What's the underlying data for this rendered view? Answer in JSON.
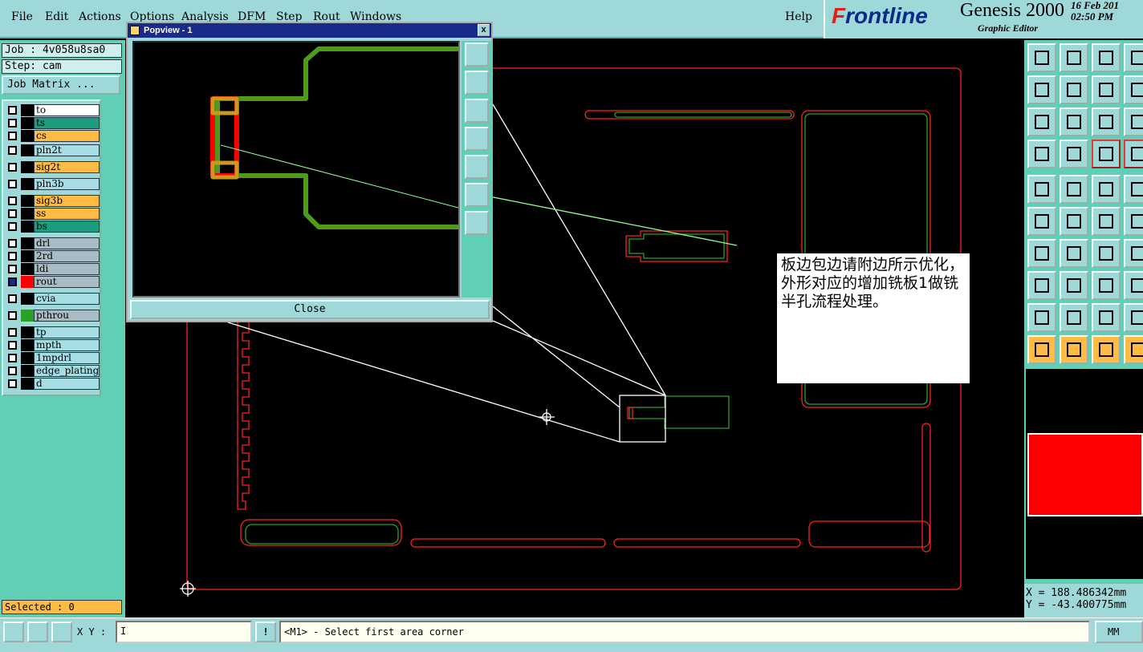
{
  "menu": [
    "File",
    "Edit",
    "Actions",
    "Options",
    "Analysis",
    "DFM",
    "Step",
    "Rout",
    "Windows"
  ],
  "help": "Help",
  "brand": {
    "logo_prefix": "F",
    "logo_rest": "rontline",
    "product": "Genesis 2000",
    "subtitle": "Graphic Editor",
    "date": "16 Feb 201",
    "time": "02:50 PM"
  },
  "left": {
    "job": "Job : 4v058u8sa0",
    "step": "Step: cam",
    "job_matrix": "Job Matrix ...",
    "selected": "Selected : 0",
    "layers": [
      {
        "name": "to",
        "color": "white"
      },
      {
        "name": "ts",
        "color": "teal"
      },
      {
        "name": "cs",
        "color": "orange"
      },
      {
        "name": "pln2t",
        "color": "lblue"
      },
      {
        "name": "sig2t",
        "color": "orange"
      },
      {
        "name": "pln3b",
        "color": "lblue"
      },
      {
        "name": "sig3b",
        "color": "orange"
      },
      {
        "name": "ss",
        "color": "orange"
      },
      {
        "name": "bs",
        "color": "teal"
      },
      {
        "name": "drl",
        "color": "grey"
      },
      {
        "name": "2rd",
        "color": "grey"
      },
      {
        "name": "ldi",
        "color": "grey"
      },
      {
        "name": "rout",
        "color": "grey"
      },
      {
        "name": "cvia",
        "color": "lblue"
      },
      {
        "name": "pthrou",
        "color": "grey"
      },
      {
        "name": "tp",
        "color": "lblue"
      },
      {
        "name": "mpth",
        "color": "lblue"
      },
      {
        "name": "1mpdrl",
        "color": "lblue"
      },
      {
        "name": "edge_plating",
        "color": "lblue"
      },
      {
        "name": "d",
        "color": "lblue"
      }
    ]
  },
  "popview": {
    "title": "Popview - 1",
    "close_x": "x",
    "close_button": "Close"
  },
  "note": "板边包边请附边所示优化，外形对应的增加铣板1做铣半孔流程处理。",
  "coords": {
    "x": "X = 188.486342mm",
    "y": "Y = -43.400775mm"
  },
  "bottom": {
    "xy_label": "X Y :",
    "xy_value": "I",
    "excl": "!",
    "status": "<M1> - Select first area corner",
    "unit": "MM"
  },
  "colors": {
    "panel": "#9fd8d8",
    "accent": "#5fd0b5",
    "rout": "#ff2020",
    "outline": "#2aa02a"
  }
}
